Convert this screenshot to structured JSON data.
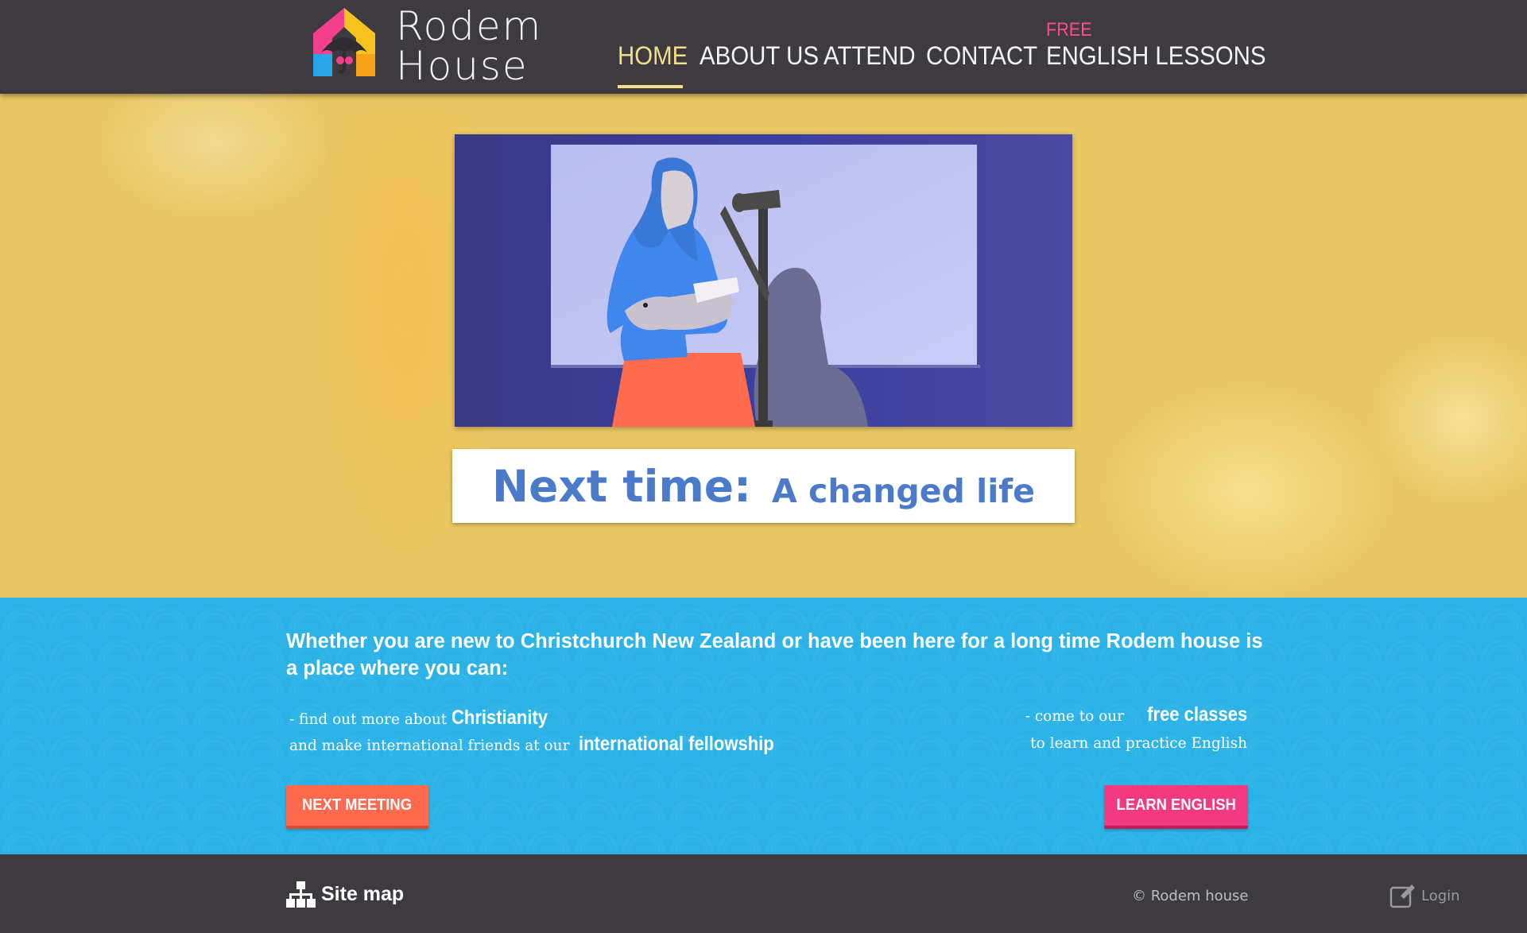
{
  "brand": {
    "name_line1": "Rodem",
    "name_line2": "House"
  },
  "nav": {
    "items": [
      {
        "label": "HOME",
        "active": true
      },
      {
        "label": "ABOUT US",
        "active": false
      },
      {
        "label": "ATTEND",
        "active": false
      },
      {
        "label": "CONTACT",
        "active": false
      },
      {
        "label": "ENGLISH LESSONS",
        "active": false
      }
    ],
    "free_badge": "FREE"
  },
  "hero": {
    "headline_main": "Next time:",
    "headline_sub": "A changed life"
  },
  "intro": {
    "lead": "Whether you are new to Christchurch New Zealand or have been here for a long time Rodem house is a place where you can:",
    "left_line1_prefix": "- find out more about",
    "left_line1_highlight": "Christianity",
    "left_line2_prefix": "and make international friends at our",
    "left_line2_highlight": "international fellowship",
    "right_line1_prefix": "- come to our",
    "right_line1_highlight": "free classes",
    "right_line2": "to learn and practice English",
    "button_meeting": "NEXT MEETING",
    "button_english": "LEARN ENGLISH"
  },
  "footer": {
    "sitemap": "Site map",
    "copyright": "© Rodem house",
    "login": "Login"
  },
  "colors": {
    "header_bg": "#3d3b3f",
    "nav_active": "#f3de8a",
    "free_badge": "#ff4a8d",
    "hero_bg": "#e9c763",
    "headline": "#4a7ac9",
    "intro_bg": "#2bb3e8",
    "button_meeting": "#ff6a4f",
    "button_english": "#f3397f"
  },
  "icons": {
    "logo": "house-umbrella-logo",
    "sitemap": "sitemap-icon",
    "login": "edit-pencil-icon"
  }
}
